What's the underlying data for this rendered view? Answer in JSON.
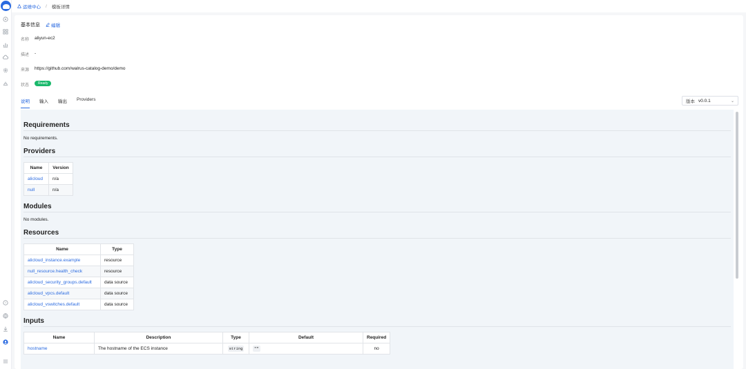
{
  "breadcrumb": {
    "parent": "运维中心",
    "current": "模板详情"
  },
  "basic_info": {
    "title": "基本信息",
    "edit_label": "编辑",
    "fields": [
      {
        "label": "名称",
        "value": "aliyun-ec2"
      },
      {
        "label": "描述",
        "value": "-"
      },
      {
        "label": "来源",
        "value": "https://github.com/walrus-catalog-demo/demo"
      },
      {
        "label": "状态",
        "value": "Ready"
      }
    ]
  },
  "tabs": [
    "说明",
    "输入",
    "输出",
    "Providers"
  ],
  "version_select": {
    "label": "版本",
    "value": "v0.0.1"
  },
  "readme": {
    "requirements": {
      "title": "Requirements",
      "text": "No requirements."
    },
    "providers": {
      "title": "Providers",
      "headers": [
        "Name",
        "Version"
      ],
      "rows": [
        [
          "alicloud",
          "n/a"
        ],
        [
          "null",
          "n/a"
        ]
      ]
    },
    "modules": {
      "title": "Modules",
      "text": "No modules."
    },
    "resources": {
      "title": "Resources",
      "headers": [
        "Name",
        "Type"
      ],
      "rows": [
        [
          "alicloud_instance.example",
          "resource"
        ],
        [
          "null_resource.health_check",
          "resource"
        ],
        [
          "alicloud_security_groups.default",
          "data source"
        ],
        [
          "alicloud_vpcs.default",
          "data source"
        ],
        [
          "alicloud_vswitches.default",
          "data source"
        ]
      ]
    },
    "inputs": {
      "title": "Inputs",
      "headers": [
        "Name",
        "Description",
        "Type",
        "Default",
        "Required"
      ],
      "rows": [
        [
          "hostname",
          "The hostname of the ECS instance",
          "string",
          "\"\"",
          "no"
        ]
      ]
    }
  },
  "colors": {
    "accent": "#2a6ae0",
    "status_ready": "#19b86b"
  },
  "sidebar_icons": [
    "dashboard-icon",
    "grid-icon",
    "chart-icon",
    "cloud-icon",
    "settings-icon",
    "deploy-icon",
    "help-icon",
    "globe-icon",
    "download-icon",
    "user-icon",
    "menu-icon"
  ]
}
